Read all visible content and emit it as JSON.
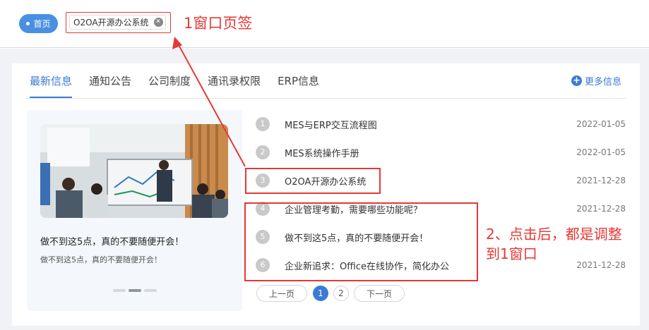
{
  "topbar": {
    "home_tab": "首页",
    "open_tab": "O2OA开源办公系统",
    "annotation": "1窗口页签"
  },
  "tabs": [
    "最新信息",
    "通知公告",
    "公司制度",
    "通讯录权限",
    "ERP信息"
  ],
  "active_tab": 0,
  "more_info": "更多信息",
  "card": {
    "title": "做不到这5点，真的不要随便开会！",
    "subtitle": "做不到这5点，真的不要随便开会！",
    "carousel_active": 2,
    "carousel_count": 3
  },
  "list": [
    {
      "num": "1",
      "title": "MES与ERP交互流程图",
      "date": "2022-01-05"
    },
    {
      "num": "2",
      "title": "MES系统操作手册",
      "date": "2022-01-05"
    },
    {
      "num": "3",
      "title": "O2OA开源办公系统",
      "date": "2021-12-28"
    },
    {
      "num": "4",
      "title": "企业管理考勤，需要哪些功能呢？",
      "date": "2021-12-28"
    },
    {
      "num": "5",
      "title": "做不到这5点，真的不要随便开会！",
      "date": ""
    },
    {
      "num": "6",
      "title": "企业新追求：Office在线协作，简化办公",
      "date": "2021-12-28"
    }
  ],
  "annotation2": [
    "2、点击后，都是调整",
    "到1窗口"
  ],
  "pager": {
    "prev": "上一页",
    "pages": [
      "1",
      "2"
    ],
    "current": "1",
    "next": "下一页"
  },
  "colors": {
    "accent": "#3a7bd5",
    "annotation": "#e53935"
  }
}
